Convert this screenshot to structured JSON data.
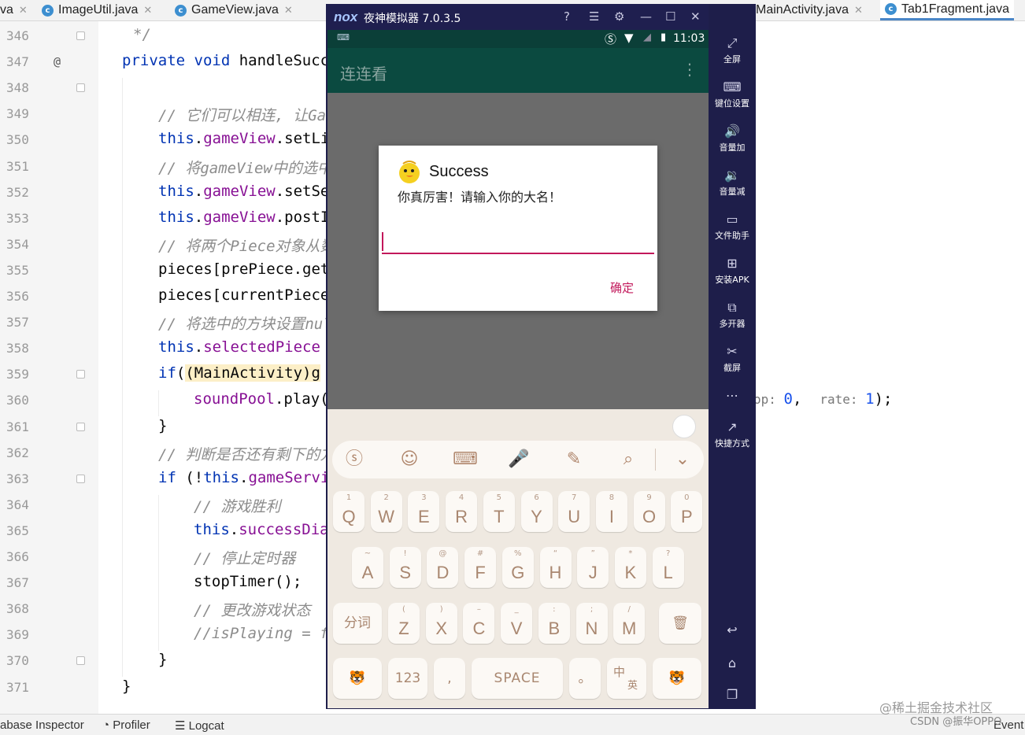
{
  "ide": {
    "tabs": [
      {
        "label": "va",
        "icon": "",
        "active": false
      },
      {
        "label": "ImageUtil.java",
        "icon": "c",
        "active": false
      },
      {
        "label": "GameView.java",
        "icon": "c",
        "active": false
      },
      {
        "label": "MainActivity.java",
        "icon": "",
        "active": false
      },
      {
        "label": "Tab1Fragment.java",
        "icon": "c",
        "active": true
      }
    ],
    "line_numbers": [
      "346",
      "347",
      "348",
      "349",
      "350",
      "351",
      "352",
      "353",
      "354",
      "355",
      "356",
      "357",
      "358",
      "359",
      "360",
      "361",
      "362",
      "363",
      "364",
      "365",
      "366",
      "367",
      "368",
      "369",
      "370",
      "371"
    ],
    "override_marker": "@",
    "code_lines": [
      {
        "text": "*/",
        "cls": "cmt",
        "indent": 44
      },
      {
        "text": "private void handleSucc",
        "cls": "kwline",
        "indent": 30
      },
      {
        "text": "",
        "cls": "plain",
        "indent": 30
      },
      {
        "text": "// 它们可以相连, 让Gam",
        "cls": "cmt",
        "indent": 76
      },
      {
        "text": "this.gameView.setLi",
        "cls": "thisline",
        "indent": 76
      },
      {
        "text": "// 将gameView中的选中",
        "cls": "cmt",
        "indent": 76
      },
      {
        "text": "this.gameView.setSe",
        "cls": "thisline",
        "indent": 76
      },
      {
        "text": "this.gameView.postI",
        "cls": "thisline",
        "indent": 76
      },
      {
        "text": "// 将两个Piece对象从数",
        "cls": "cmt",
        "indent": 76
      },
      {
        "text": "pieces[prePiece.get",
        "cls": "plain",
        "indent": 76
      },
      {
        "text": "pieces[currentPiece",
        "cls": "plain",
        "indent": 76
      },
      {
        "text": "// 将选中的方块设置nul",
        "cls": "cmt",
        "indent": 76
      },
      {
        "text": "this.selectedPiece",
        "cls": "thisline2",
        "indent": 76
      },
      {
        "text": "if((MainActivity)g",
        "cls": "ifline",
        "indent": 76
      },
      {
        "text": "soundPool.play(",
        "cls": "sound",
        "indent": 121
      },
      {
        "text": "}",
        "cls": "plain",
        "indent": 76
      },
      {
        "text": "// 判断是否还有剩下的方",
        "cls": "cmt",
        "indent": 76
      },
      {
        "text": "if (!this.gameServi",
        "cls": "ifthis",
        "indent": 76
      },
      {
        "text": "// 游戏胜利",
        "cls": "cmt",
        "indent": 121
      },
      {
        "text": "this.successDia",
        "cls": "thisline2",
        "indent": 121
      },
      {
        "text": "// 停止定时器",
        "cls": "cmt",
        "indent": 121
      },
      {
        "text": "stopTimer();",
        "cls": "plain",
        "indent": 121
      },
      {
        "text": "// 更改游戏状态",
        "cls": "cmt",
        "indent": 121
      },
      {
        "text": "//isPlaying = f",
        "cls": "cmt",
        "indent": 121
      },
      {
        "text": "}",
        "cls": "plain",
        "indent": 76
      },
      {
        "text": "}",
        "cls": "plain",
        "indent": 30
      }
    ],
    "right_of_emulator": {
      "prefix": "op:",
      "loop_value": "0",
      "sep": ",",
      "hint": "rate:",
      "rate_value": "1",
      "suffix": ");"
    },
    "bottom_tools": [
      {
        "label": "abase Inspector",
        "icon": ""
      },
      {
        "label": "Profiler",
        "icon": "profiler-icon"
      },
      {
        "label": "Logcat",
        "icon": "logcat-icon"
      }
    ],
    "event_label": "Event"
  },
  "emulator": {
    "logo": "nox",
    "title": "夜神模拟器 7.0.3.5",
    "status_time": "11:03",
    "app_title": "连连看",
    "dialog": {
      "title": "Success",
      "message": "你真厉害！请输入你的大名！",
      "input_value": "",
      "ok_label": "确定"
    },
    "keyboard": {
      "row1": [
        {
          "k": "Q",
          "s": "1"
        },
        {
          "k": "W",
          "s": "2"
        },
        {
          "k": "E",
          "s": "3"
        },
        {
          "k": "R",
          "s": "4"
        },
        {
          "k": "T",
          "s": "5"
        },
        {
          "k": "Y",
          "s": "6"
        },
        {
          "k": "U",
          "s": "7"
        },
        {
          "k": "I",
          "s": "8"
        },
        {
          "k": "O",
          "s": "9"
        },
        {
          "k": "P",
          "s": "0"
        }
      ],
      "row2": [
        {
          "k": "A",
          "s": "~"
        },
        {
          "k": "S",
          "s": "!"
        },
        {
          "k": "D",
          "s": "@"
        },
        {
          "k": "F",
          "s": "#"
        },
        {
          "k": "G",
          "s": "%"
        },
        {
          "k": "H",
          "s": "“"
        },
        {
          "k": "J",
          "s": "”"
        },
        {
          "k": "K",
          "s": "*"
        },
        {
          "k": "L",
          "s": "?"
        }
      ],
      "row3": [
        {
          "k": "Z",
          "s": "("
        },
        {
          "k": "X",
          "s": ")"
        },
        {
          "k": "C",
          "s": "–"
        },
        {
          "k": "V",
          "s": "_"
        },
        {
          "k": "B",
          "s": ":"
        },
        {
          "k": "N",
          "s": ";"
        },
        {
          "k": "M",
          "s": "/"
        }
      ],
      "fenci": "分词",
      "num_key": "123",
      "comma": ",",
      "space": "SPACE",
      "period": "。",
      "lang_top": "中",
      "lang_bottom": "英"
    },
    "sidebar": [
      {
        "label": "全屏",
        "icon": "fullscreen-icon",
        "glyph": "⤢"
      },
      {
        "label": "键位设置",
        "icon": "keyboard-icon",
        "glyph": "⌨"
      },
      {
        "label": "音量加",
        "icon": "volume-up-icon",
        "glyph": "🔊"
      },
      {
        "label": "音量减",
        "icon": "volume-down-icon",
        "glyph": "🔉"
      },
      {
        "label": "文件助手",
        "icon": "file-icon",
        "glyph": "▭"
      },
      {
        "label": "安装APK",
        "icon": "apk-icon",
        "glyph": "⊞"
      },
      {
        "label": "多开器",
        "icon": "multi-icon",
        "glyph": "⧉"
      },
      {
        "label": "截屏",
        "icon": "scissors-icon",
        "glyph": "✂"
      },
      {
        "label": "",
        "icon": "more-icon",
        "glyph": "⋯"
      },
      {
        "label": "快捷方式",
        "icon": "shortcut-icon",
        "glyph": "↗"
      }
    ]
  },
  "watermark": {
    "line1": "@稀土掘金技术社区",
    "line2": "CSDN @振华OPPO"
  }
}
